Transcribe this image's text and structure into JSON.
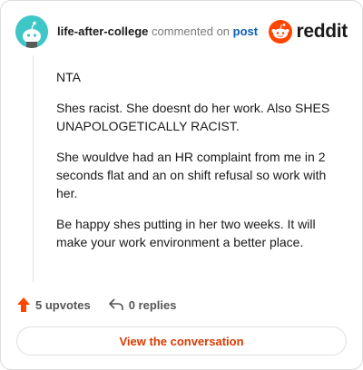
{
  "header": {
    "username": "life-after-college",
    "commented_text": "commented on",
    "post_link": "post",
    "logo_word": "reddit",
    "avatar_icon": "snoo-avatar-icon",
    "brand_color": "#ff4500",
    "avatar_color": "#3fc7c7"
  },
  "comment": {
    "paragraphs": [
      "NTA",
      "Shes racist. She doesnt do her work. Also SHES UNAPOLOGETICALLY RACIST.",
      "She wouldve had an HR complaint from me in 2 seconds flat and an on shift refusal so work with her.",
      "Be happy shes putting in her two weeks. It will make your work environment a better place."
    ]
  },
  "actions": {
    "upvotes": "5 upvotes",
    "replies": "0 replies",
    "upvote_icon": "upvote-arrow-icon",
    "reply_icon": "reply-arrow-icon"
  },
  "button": {
    "view_label": "View the conversation",
    "accent": "#d93a00"
  }
}
